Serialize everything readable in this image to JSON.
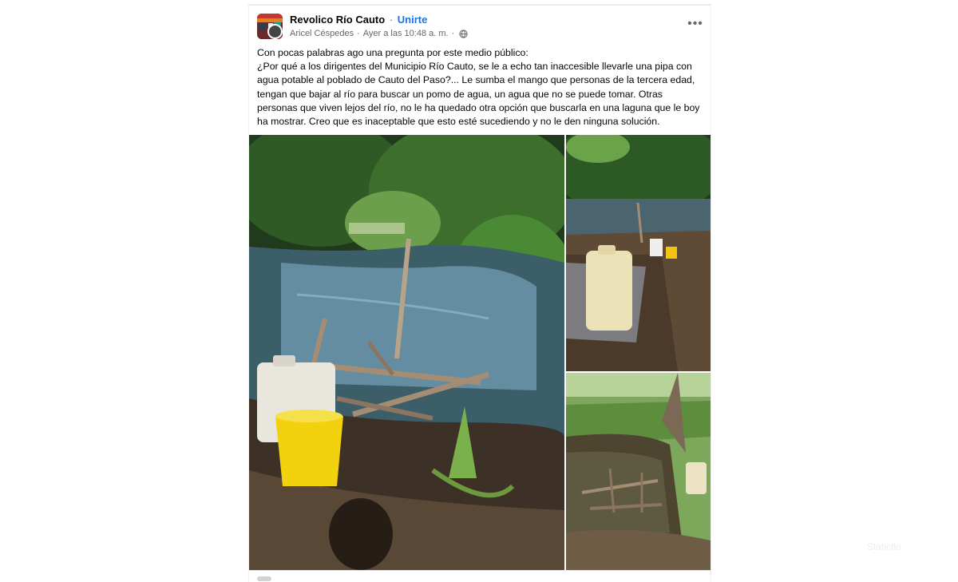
{
  "post": {
    "group_name": "Revolico Río Cauto",
    "separator": "·",
    "join_label": "Unirte",
    "author": "Aricel Céspedes",
    "timestamp": "Ayer a las 10:48 a. m.",
    "more_label": "•••",
    "body": "Con pocas palabras ago una pregunta por este medio público:\n¿Por qué a los dirigentes del Municipio Río Cauto, se le a echo tan inaccesible llevarle una pipa con\nagua potable al poblado de Cauto del Paso?... Le sumba el mango que personas de la tercera edad,\ntengan que bajar al río para buscar un pomo de agua, un agua que no se puede tomar. Otras\npersonas que viven lejos del río, no le ha quedado otra opción que buscarla en una laguna que le boy\nha mostrar. Creo que es inaceptable que esto esté sucediendo y no le den ninguna solución."
  },
  "photos": {
    "count": 3
  },
  "icons": {
    "avatar": "group-avatar",
    "privacy": "globe-icon",
    "more": "more-options-icon"
  },
  "colors": {
    "link": "#1b74e4",
    "text": "#050505",
    "secondary": "#65676b"
  },
  "watermark": "Staticflo"
}
